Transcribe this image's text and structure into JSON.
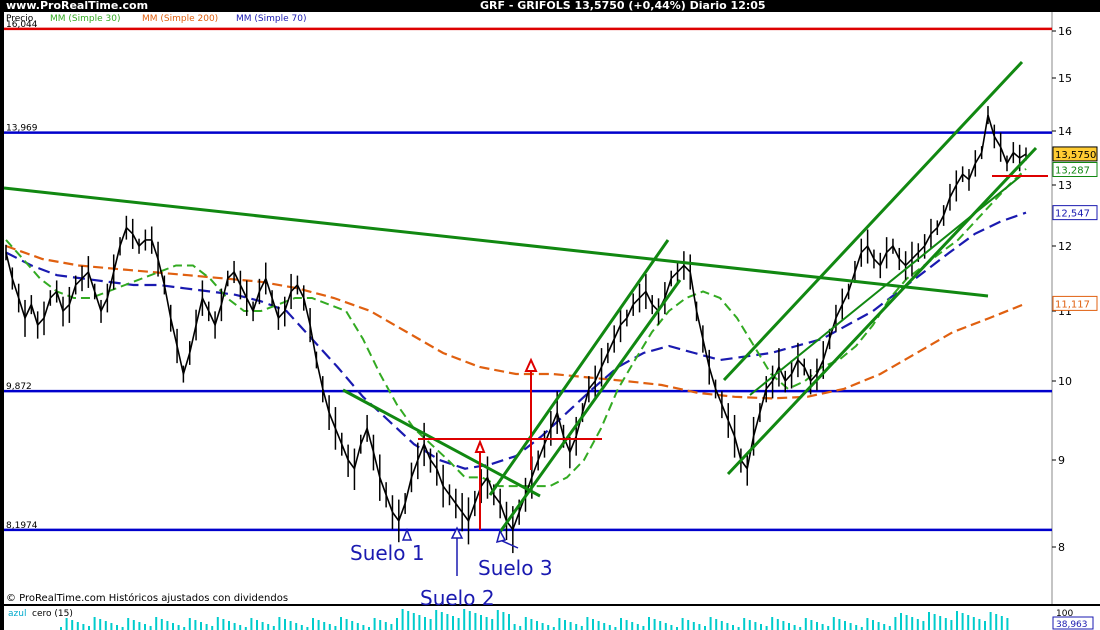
{
  "header": {
    "site": "www.ProRealTime.com",
    "title": "GRF - GRIFOLS    13,5750 (+0,44%)    Diario  12:05",
    "footer": "© ProRealTime.com Históricos ajustados con dividendos"
  },
  "legend": {
    "price": "Precio",
    "ma30": "MM (Simple 30)",
    "ma200": "MM (Simple 200)",
    "ma70": "MM (Simple 70)"
  },
  "volume_panel": {
    "label": "azul",
    "label2": "cero (15)",
    "value_tag": "38,963",
    "top_tick": "100"
  },
  "colors": {
    "price": "#000000",
    "ma30": "#33aa22",
    "ma200": "#e06010",
    "ma70": "#1a1ab0",
    "hline_red": "#dd0000",
    "hline_blue": "#0000cc",
    "trend_green": "#118811",
    "volume": "#00cccc"
  },
  "chart_data": {
    "type": "line",
    "title": "GRF - GRIFOLS    13,5750 (+0,44%)    Diario  12:05",
    "y_ticks": [
      "8",
      "9",
      "10",
      "11",
      "12",
      "13",
      "14",
      "15",
      "16"
    ],
    "ylim": [
      7.8,
      16.4
    ],
    "grid": false,
    "legend_position": "top-left",
    "horizontal_levels": [
      {
        "value": 16.044,
        "label": "16,044",
        "color": "#dd0000"
      },
      {
        "value": 13.969,
        "label": "13,969",
        "color": "#0000cc"
      },
      {
        "value": 9.872,
        "label": "9,872",
        "color": "#0000cc"
      },
      {
        "value": 8.1974,
        "label": "8,1974",
        "color": "#0000cc"
      }
    ],
    "right_tags": [
      {
        "value": 13.575,
        "label": "13,5750",
        "bg": "#ffcc33",
        "fg": "#000000"
      },
      {
        "value": 13.287,
        "label": "13,287",
        "bg": "#ffffff",
        "fg": "#118811"
      },
      {
        "value": 12.547,
        "label": "12,547",
        "bg": "#ffffff",
        "fg": "#1a1ab0"
      },
      {
        "value": 11.117,
        "label": "11,117",
        "bg": "#ffffff",
        "fg": "#e06010"
      }
    ],
    "price_series": {
      "name": "Precio",
      "values": [
        11.9,
        11.5,
        11.2,
        10.9,
        11.1,
        10.8,
        10.9,
        11.2,
        11.3,
        11.0,
        11.1,
        11.4,
        11.5,
        11.6,
        11.3,
        11.0,
        11.2,
        11.6,
        12.0,
        12.3,
        12.2,
        12.0,
        12.1,
        12.1,
        11.8,
        11.4,
        10.9,
        10.5,
        10.1,
        10.4,
        10.8,
        11.2,
        11.0,
        10.8,
        11.1,
        11.5,
        11.6,
        11.4,
        11.2,
        11.0,
        11.3,
        11.5,
        11.2,
        10.9,
        11.0,
        11.3,
        11.4,
        11.2,
        10.8,
        10.3,
        9.9,
        9.6,
        9.4,
        9.2,
        9.0,
        8.9,
        9.2,
        9.4,
        9.1,
        8.8,
        8.6,
        8.4,
        8.3,
        8.5,
        8.8,
        9.0,
        9.2,
        9.0,
        8.9,
        8.7,
        8.6,
        8.5,
        8.4,
        8.3,
        8.5,
        8.7,
        8.8,
        8.6,
        8.5,
        8.3,
        8.2,
        8.4,
        8.6,
        8.8,
        9.0,
        9.2,
        9.4,
        9.6,
        9.3,
        9.1,
        9.3,
        9.6,
        9.9,
        10.0,
        10.2,
        10.4,
        10.6,
        10.8,
        10.9,
        11.1,
        11.2,
        11.3,
        11.1,
        11.0,
        11.2,
        11.5,
        11.6,
        11.7,
        11.6,
        11.0,
        10.6,
        10.2,
        9.9,
        9.7,
        9.5,
        9.3,
        9.0,
        8.9,
        9.3,
        9.6,
        9.9,
        10.0,
        10.2,
        10.0,
        10.1,
        10.3,
        10.2,
        10.0,
        10.1,
        10.3,
        10.6,
        10.9,
        11.1,
        11.3,
        11.6,
        11.9,
        12.0,
        11.8,
        11.7,
        11.9,
        12.0,
        11.8,
        11.7,
        11.8,
        11.9,
        12.0,
        12.2,
        12.3,
        12.5,
        12.8,
        13.0,
        13.2,
        13.1,
        13.4,
        13.6,
        14.3,
        13.9,
        13.7,
        13.4,
        13.6,
        13.5,
        13.575
      ]
    },
    "ma30_series": {
      "name": "MM (Simple 30)",
      "values": [
        12.1,
        11.8,
        11.5,
        11.3,
        11.2,
        11.2,
        11.3,
        11.4,
        11.5,
        11.6,
        11.7,
        11.7,
        11.5,
        11.2,
        11.0,
        11.0,
        11.1,
        11.2,
        11.2,
        11.1,
        11.0,
        10.6,
        10.1,
        9.7,
        9.4,
        9.2,
        9.0,
        8.8,
        8.8,
        8.7,
        8.7,
        8.7,
        8.7,
        8.8,
        9.0,
        9.4,
        9.9,
        10.3,
        10.7,
        11.0,
        11.2,
        11.3,
        11.2,
        10.9,
        10.5,
        10.1,
        9.9,
        10.0,
        10.2,
        10.3,
        10.5,
        10.8,
        11.2,
        11.5,
        11.7,
        11.9,
        12.1,
        12.4,
        12.7,
        13.0,
        13.3
      ]
    },
    "ma70_series": {
      "name": "MM (Simple 70)",
      "values": [
        11.9,
        11.7,
        11.55,
        11.5,
        11.45,
        11.4,
        11.4,
        11.35,
        11.3,
        11.25,
        11.15,
        11.0,
        10.6,
        10.2,
        9.8,
        9.5,
        9.2,
        9.0,
        8.9,
        8.95,
        9.05,
        9.3,
        9.6,
        9.9,
        10.2,
        10.4,
        10.5,
        10.4,
        10.3,
        10.35,
        10.4,
        10.5,
        10.6,
        10.8,
        11.0,
        11.3,
        11.6,
        11.9,
        12.2,
        12.4,
        12.547
      ]
    },
    "ma200_series": {
      "name": "MM (Simple 200)",
      "values": [
        12.0,
        11.8,
        11.7,
        11.65,
        11.6,
        11.55,
        11.5,
        11.45,
        11.35,
        11.2,
        11.0,
        10.7,
        10.4,
        10.2,
        10.1,
        10.1,
        10.05,
        10.0,
        9.95,
        9.85,
        9.8,
        9.78,
        9.8,
        9.9,
        10.1,
        10.4,
        10.7,
        10.9,
        11.117
      ]
    },
    "annotations": [
      "Suelo 1",
      "Suelo 2",
      "Suelo 3"
    ]
  }
}
